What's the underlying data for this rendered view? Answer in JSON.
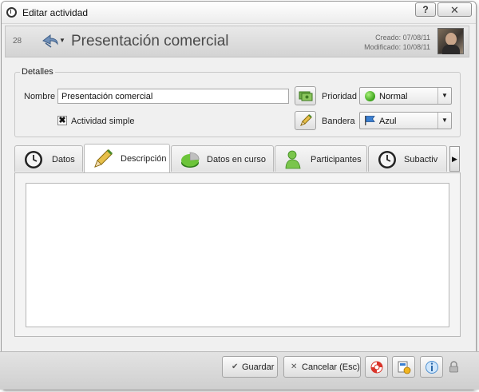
{
  "window": {
    "title": "Editar actividad",
    "help_label": "?",
    "close_label": "✕"
  },
  "header": {
    "id": "28",
    "title": "Presentación comercial",
    "created": "Creado: 07/08/11",
    "modified": "Modificado: 10/08/11"
  },
  "details": {
    "legend": "Detalles",
    "name_label": "Nombre",
    "name_value": "Presentación comercial",
    "simple_activity_label": "Actividad simple",
    "simple_activity_checked": true,
    "priority_label": "Prioridad",
    "priority_value": "Normal",
    "flag_label": "Bandera",
    "flag_value": "Azul",
    "checkmark": "✖"
  },
  "tabs": [
    {
      "label": "Datos",
      "icon": "clock-icon"
    },
    {
      "label": "Descripción",
      "icon": "pencil-icon",
      "active": true
    },
    {
      "label": "Datos en curso",
      "icon": "pie-chart-icon"
    },
    {
      "label": "Participantes",
      "icon": "person-icon"
    },
    {
      "label": "Subactiv",
      "icon": "clock-icon"
    }
  ],
  "tab_scroll": {
    "left": "◀",
    "right": "▶"
  },
  "editor": {
    "content": ""
  },
  "footer": {
    "save_label": "Guardar",
    "save_icon": "✔",
    "cancel_label": "Cancelar (Esc)",
    "cancel_icon": "✕"
  },
  "colors": {
    "window_bg": "#f0f0f0",
    "title_text": "#4a4a4a",
    "priority_green": "#3aa21a",
    "flag_blue": "#3a7fd0"
  }
}
